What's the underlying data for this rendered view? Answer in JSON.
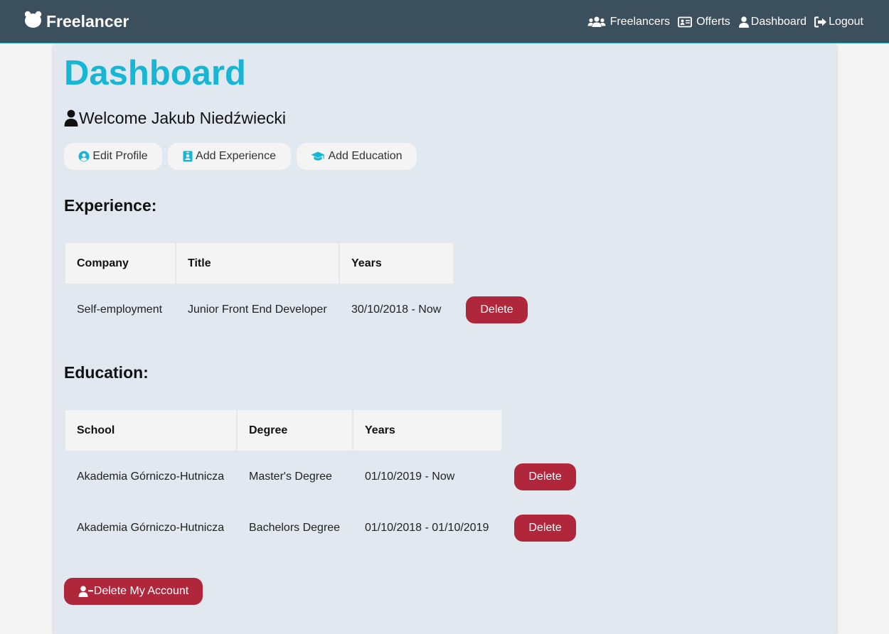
{
  "nav": {
    "brand": "Freelancer",
    "links": [
      {
        "label": "Freelancers",
        "icon": "users-icon"
      },
      {
        "label": "Offerts",
        "icon": "id-card-icon"
      },
      {
        "label": "Dashboard",
        "icon": "user-icon"
      },
      {
        "label": "Logout",
        "icon": "sign-out-icon"
      }
    ]
  },
  "page": {
    "title": "Dashboard",
    "welcome": "Welcome Jakub Niedźwiecki"
  },
  "actions": {
    "edit_profile": "Edit Profile",
    "add_experience": "Add Experience",
    "add_education": "Add Education"
  },
  "experience": {
    "heading": "Experience:",
    "columns": [
      "Company",
      "Title",
      "Years"
    ],
    "rows": [
      {
        "company": "Self-employment",
        "title": "Junior Front End Developer",
        "years": "30/10/2018 - Now",
        "action": "Delete"
      }
    ]
  },
  "education": {
    "heading": "Education:",
    "columns": [
      "School",
      "Degree",
      "Years"
    ],
    "rows": [
      {
        "school": "Akademia Górniczo-Hutnicza",
        "degree": "Master's Degree",
        "years": "01/10/2019 - Now",
        "action": "Delete"
      },
      {
        "school": "Akademia Górniczo-Hutnicza",
        "degree": "Bachelors Degree",
        "years": "01/10/2018 - 01/10/2019",
        "action": "Delete"
      }
    ]
  },
  "delete_account": "Delete My Account",
  "colors": {
    "navbar": "#3c4f5c",
    "accent": "#17b6d4",
    "danger": "#b0263a",
    "panel": "#e2e8ef"
  }
}
